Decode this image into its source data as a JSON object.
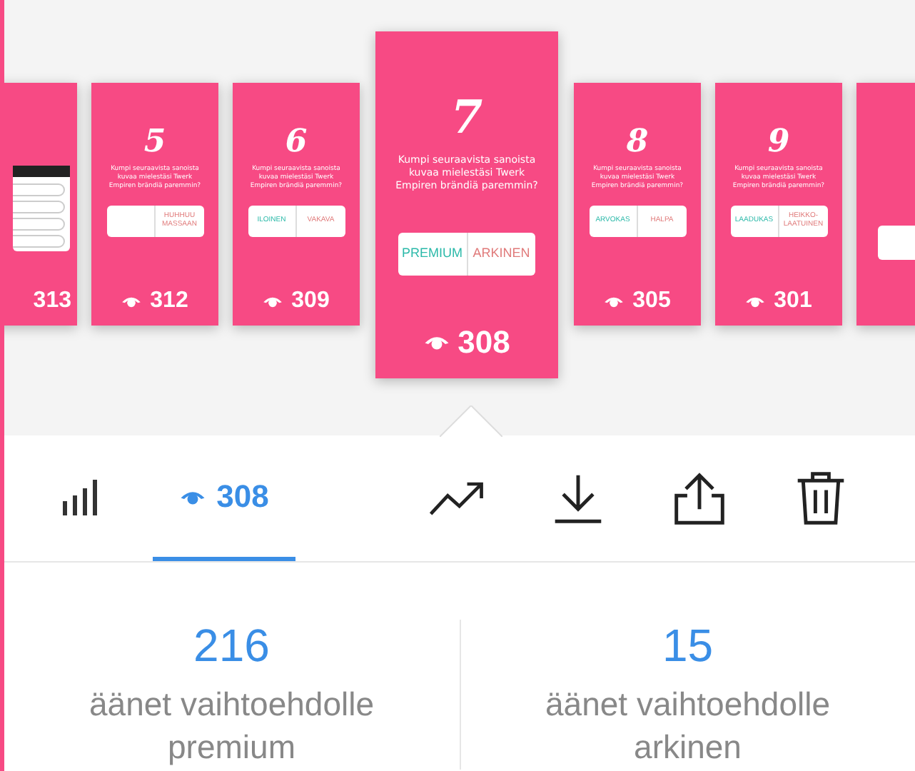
{
  "cards": [
    {
      "kind": "form",
      "views": "313",
      "selected": false
    },
    {
      "kind": "poll",
      "number": "5",
      "question": "Kumpi seuraavista sanoista kuvaa mielestäsi Twerk Empiren brändiä paremmin?",
      "options": [
        {
          "kind": "right",
          "text": "HUHHUU MASSAAN"
        }
      ],
      "views": "312",
      "selected": false
    },
    {
      "kind": "poll",
      "number": "6",
      "question": "Kumpi seuraavista sanoista kuvaa mielestäsi Twerk Empiren brändiä paremmin?",
      "options": [
        {
          "kind": "left",
          "text": "ILOINEN"
        },
        {
          "kind": "right",
          "text": "VAKAVA"
        }
      ],
      "views": "309",
      "selected": false
    },
    {
      "kind": "poll",
      "number": "7",
      "question": "Kumpi seuraavista sanoista kuvaa mielestäsi Twerk Empiren brändiä paremmin?",
      "options": [
        {
          "kind": "left",
          "text": "PREMIUM"
        },
        {
          "kind": "right",
          "text": "ARKINEN"
        }
      ],
      "views": "308",
      "selected": true
    },
    {
      "kind": "poll",
      "number": "8",
      "question": "Kumpi seuraavista sanoista kuvaa mielestäsi Twerk Empiren brändiä paremmin?",
      "options": [
        {
          "kind": "left",
          "text": "ARVOKAS"
        },
        {
          "kind": "right",
          "text": "HALPA"
        }
      ],
      "views": "305",
      "selected": false
    },
    {
      "kind": "poll",
      "number": "9",
      "question": "Kumpi seuraavista sanoista kuvaa mielestäsi Twerk Empiren brändiä paremmin?",
      "options": [
        {
          "kind": "left",
          "text": "LAADUKAS"
        },
        {
          "kind": "right",
          "text": "HEIKKO-LAATUINEN"
        }
      ],
      "views": "301",
      "selected": false
    },
    {
      "kind": "cut",
      "selected": false
    }
  ],
  "tabs": [
    {
      "kind": "stats",
      "selected": false
    },
    {
      "kind": "views",
      "label": "308",
      "selected": true
    }
  ],
  "actions": [
    {
      "kind": "trend"
    },
    {
      "kind": "download"
    },
    {
      "kind": "share"
    },
    {
      "kind": "delete"
    }
  ],
  "results": [
    {
      "value": "216",
      "label": "äänet vaihtoehdolle premium"
    },
    {
      "value": "15",
      "label": "äänet vaihtoehdolle arkinen"
    }
  ]
}
